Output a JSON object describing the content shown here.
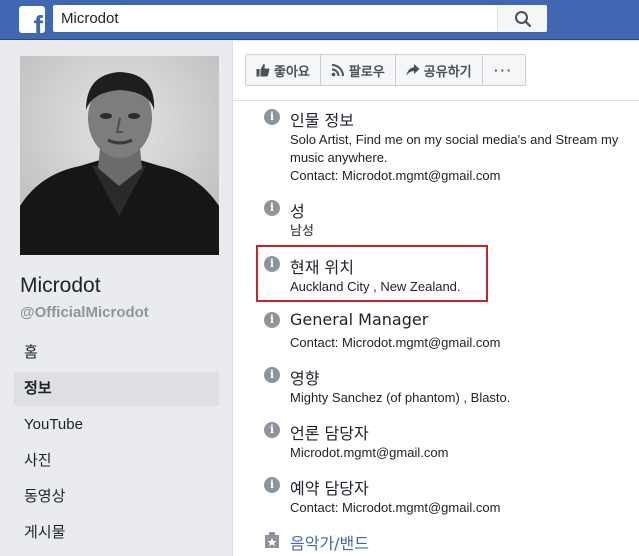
{
  "topbar": {
    "logo_letter": "f",
    "search_value": "Microdot"
  },
  "profile": {
    "name": "Microdot",
    "handle": "@OfficialMicrodot"
  },
  "nav": {
    "items": [
      {
        "label": "홈"
      },
      {
        "label": "정보"
      },
      {
        "label": "YouTube"
      },
      {
        "label": "사진"
      },
      {
        "label": "동영상"
      },
      {
        "label": "게시물"
      }
    ],
    "active_index": 1
  },
  "actions": {
    "like": "좋아요",
    "follow": "팔로우",
    "share": "공유하기",
    "more": "···"
  },
  "info": [
    {
      "title": "인물 정보",
      "lines": [
        "Solo Artist, Find me on my social media's and Stream my",
        "music anywhere.",
        "Contact: Microdot.mgmt@gmail.com"
      ]
    },
    {
      "title": "성",
      "lines": [
        "남성"
      ]
    },
    {
      "title": "현재 위치",
      "lines": [
        "Auckland City , New Zealand."
      ]
    },
    {
      "title": "General Manager",
      "lines": [
        "Contact: Microdot.mgmt@gmail.com"
      ]
    },
    {
      "title": "영향",
      "lines": [
        "Mighty Sanchez (of phantom) , Blasto."
      ]
    },
    {
      "title": "언론 담당자",
      "lines": [
        "Microdot.mgmt@gmail.com"
      ]
    },
    {
      "title": "예약 담당자",
      "lines": [
        "Contact: Microdot.mgmt@gmail.com"
      ]
    }
  ],
  "category": {
    "label": "음악가/밴드"
  },
  "colors": {
    "brand": "#4267b2",
    "highlight": "#cc1f26"
  }
}
